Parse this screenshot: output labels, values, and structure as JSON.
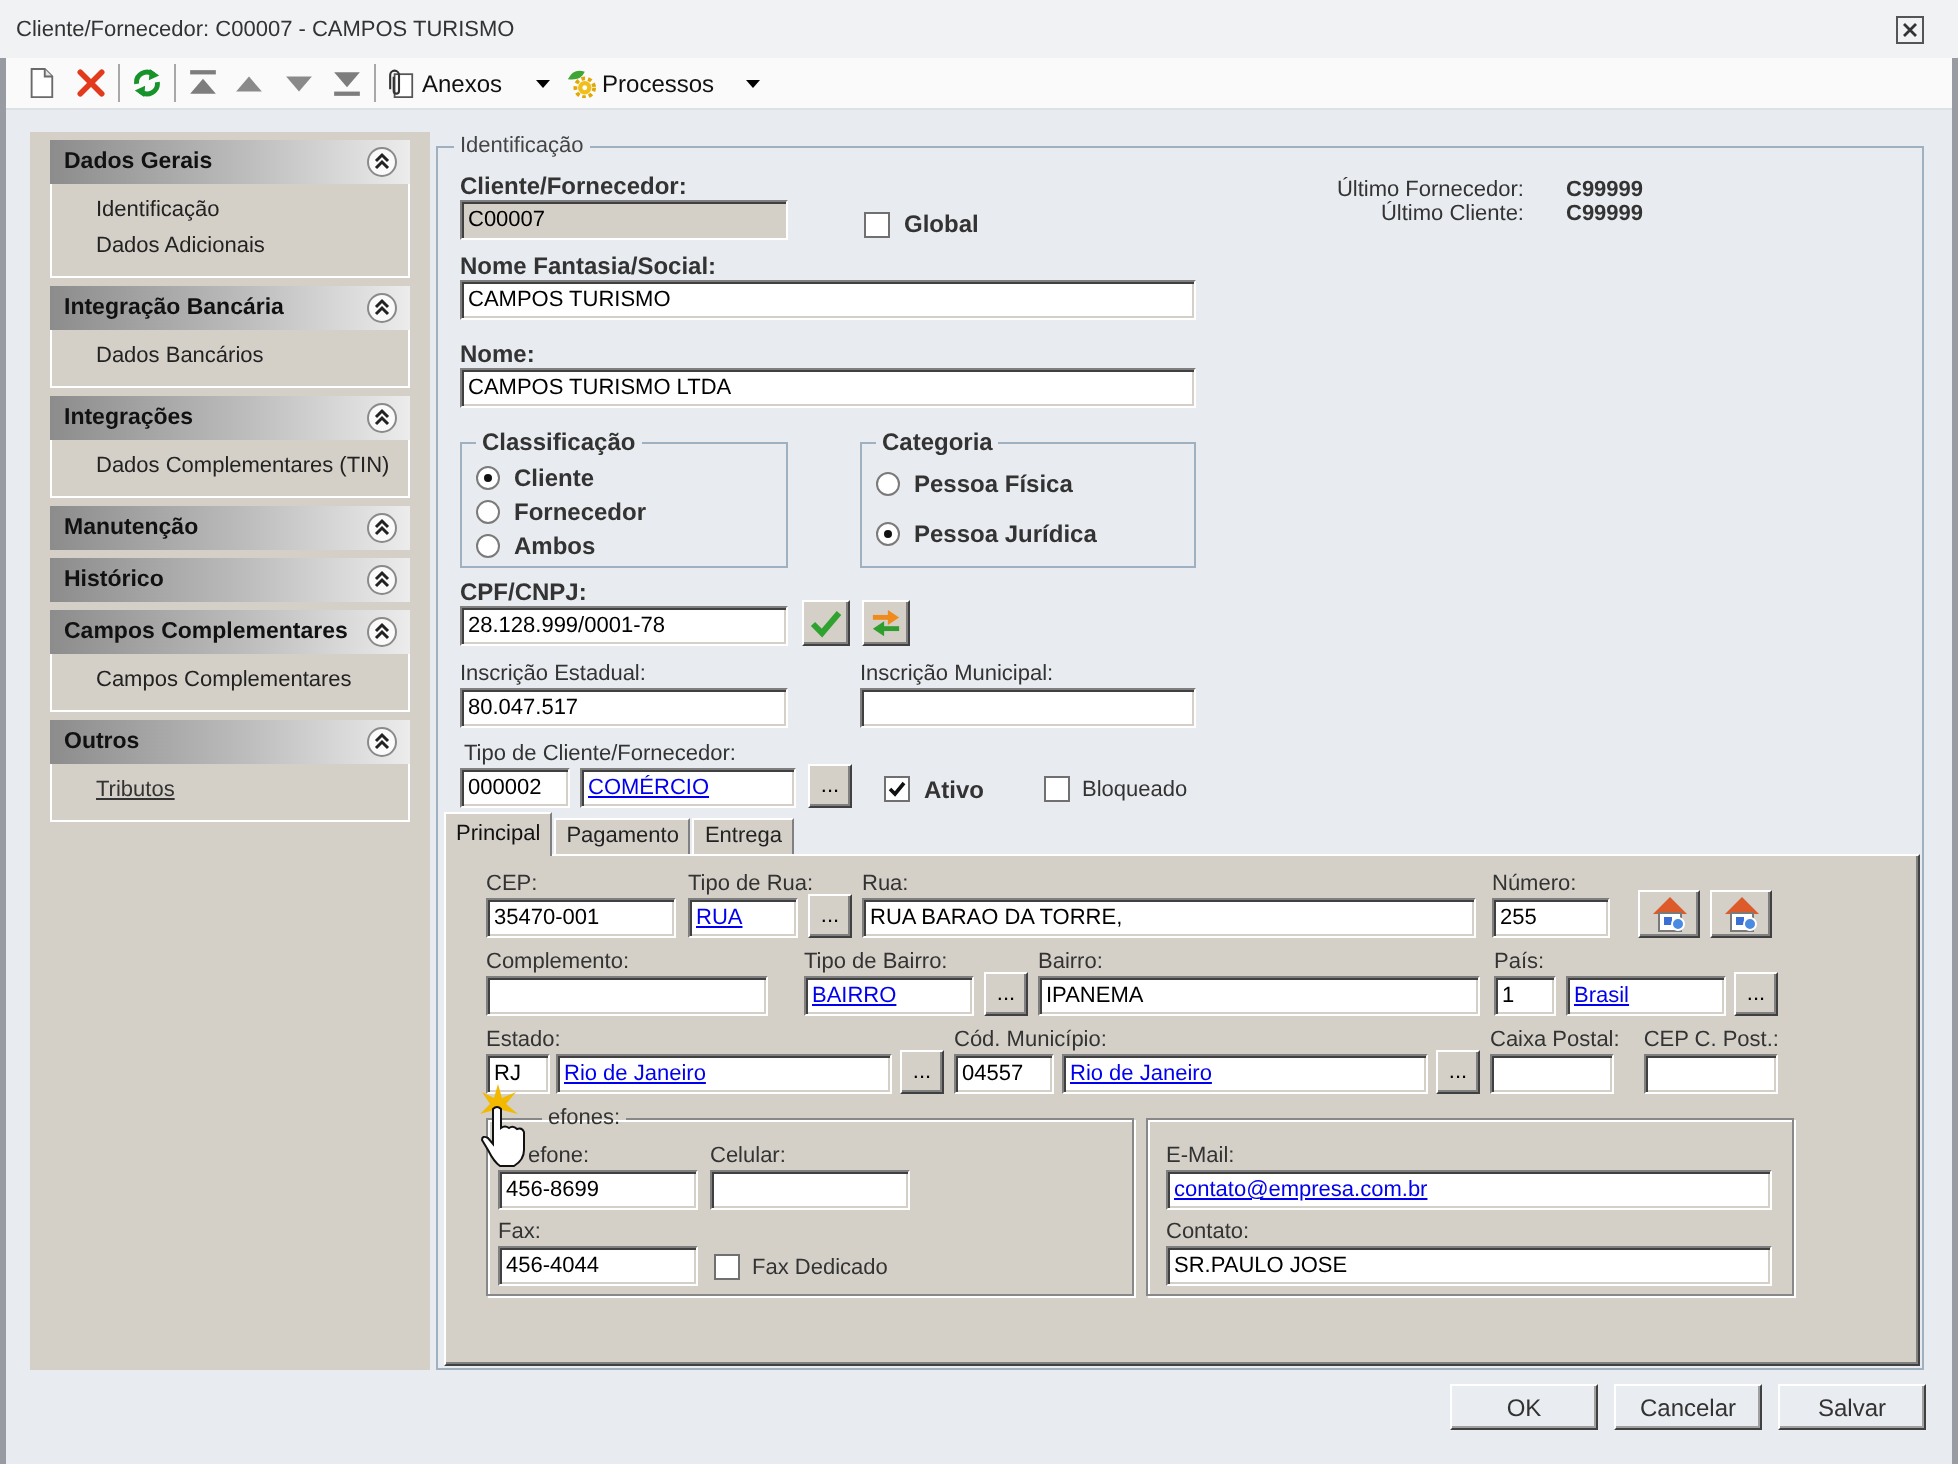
{
  "window": {
    "title": "Cliente/Fornecedor: C00007 - CAMPOS TURISMO"
  },
  "toolbar": {
    "anexos": {
      "label": "Anexos"
    },
    "processos": {
      "label": "Processos"
    }
  },
  "sidebar": {
    "sections": [
      {
        "title": "Dados Gerais",
        "items": [
          {
            "label": "Identificação",
            "hovered": false
          },
          {
            "label": "Dados Adicionais",
            "hovered": false
          }
        ]
      },
      {
        "title": "Integração Bancária",
        "items": [
          {
            "label": "Dados Bancários",
            "hovered": false
          }
        ]
      },
      {
        "title": "Integrações",
        "items": [
          {
            "label": "Dados Complementares (TIN)",
            "hovered": false
          }
        ]
      },
      {
        "title": "Manutenção"
      },
      {
        "title": "Histórico"
      },
      {
        "title": "Campos Complementares",
        "items": [
          {
            "label": "Campos Complementares",
            "hovered": false
          }
        ]
      },
      {
        "title": "Outros",
        "items": [
          {
            "label": "Tributos",
            "hovered": true
          }
        ]
      }
    ]
  },
  "identificacao": {
    "legend": "Identificação",
    "codigo": {
      "label": "Cliente/Fornecedor:",
      "value": "C00007",
      "disabled": true
    },
    "global": {
      "label": "Global",
      "checked": false
    },
    "ultimo": [
      {
        "label": "Último Fornecedor:",
        "value": "C99999"
      },
      {
        "label": "Último Cliente:",
        "value": "C99999"
      }
    ],
    "nome_fantasia": {
      "label": "Nome Fantasia/Social:",
      "value": "CAMPOS TURISMO"
    },
    "nome": {
      "label": "Nome:",
      "value": "CAMPOS TURISMO LTDA"
    },
    "classificacao": {
      "legend": "Classificação",
      "options": [
        {
          "label": "Cliente",
          "selected": true
        },
        {
          "label": "Fornecedor",
          "selected": false
        },
        {
          "label": "Ambos",
          "selected": false
        }
      ]
    },
    "categoria": {
      "legend": "Categoria",
      "options": [
        {
          "label": "Pessoa Física",
          "selected": false
        },
        {
          "label": "Pessoa Jurídica",
          "selected": true
        }
      ]
    },
    "cpf_cnpj": {
      "label": "CPF/CNPJ:",
      "value": "28.128.999/0001-78"
    },
    "inscricao_estadual": {
      "label": "Inscrição Estadual:",
      "value": "80.047.517"
    },
    "inscricao_municipal": {
      "label": "Inscrição Municipal:"
    },
    "tipo": {
      "label": "Tipo de Cliente/Fornecedor:",
      "code": "000002",
      "value": "COMÉRCIO",
      "button": "..."
    },
    "ativo": {
      "label": "Ativo",
      "checked": true
    },
    "bloqueado": {
      "label": "Bloqueado",
      "checked": false
    }
  },
  "tabs": [
    {
      "label": "Principal",
      "selected": true
    },
    {
      "label": "Pagamento",
      "selected": false
    },
    {
      "label": "Entrega",
      "selected": false
    }
  ],
  "principal": {
    "cep": {
      "label": "CEP:",
      "value": "35470-001"
    },
    "tipo_rua": {
      "label": "Tipo de Rua:",
      "value": "RUA",
      "button": "..."
    },
    "rua": {
      "label": "Rua:",
      "value": "RUA BARAO DA TORRE,"
    },
    "numero": {
      "label": "Número:",
      "value": "255"
    },
    "complemento": {
      "label": "Complemento:"
    },
    "tipo_bairro": {
      "label": "Tipo de Bairro:",
      "value": "BAIRRO",
      "button": "..."
    },
    "bairro": {
      "label": "Bairro:",
      "value": "IPANEMA"
    },
    "pais": {
      "label": "País:",
      "code": "1",
      "value": "Brasil",
      "button": "..."
    },
    "estado": {
      "label": "Estado:",
      "code": "RJ",
      "value": "Rio de Janeiro",
      "button": "..."
    },
    "municipio": {
      "label": "Cód. Município:",
      "code": "04557",
      "value": "Rio de Janeiro",
      "button": "..."
    },
    "caixa_postal": {
      "label": "Caixa Postal:"
    },
    "cep_caixa_postal": {
      "label": "CEP C. Post.:"
    },
    "telefones": {
      "legend": "efones:",
      "telefone": {
        "label": "efone:",
        "value": "456-8699"
      },
      "celular": {
        "label": "Celular:"
      },
      "fax": {
        "label": "Fax:",
        "value": "456-4044"
      },
      "fax_dedicado": {
        "label": "Fax Dedicado",
        "checked": false
      }
    },
    "contato": {
      "email": {
        "label": "E-Mail:",
        "value": "contato@empresa.com.br"
      },
      "contato": {
        "label": "Contato:",
        "value": "SR.PAULO JOSE"
      }
    }
  },
  "buttons": [
    {
      "label": "OK"
    },
    {
      "label": "Cancelar"
    },
    {
      "label": "Salvar"
    }
  ]
}
